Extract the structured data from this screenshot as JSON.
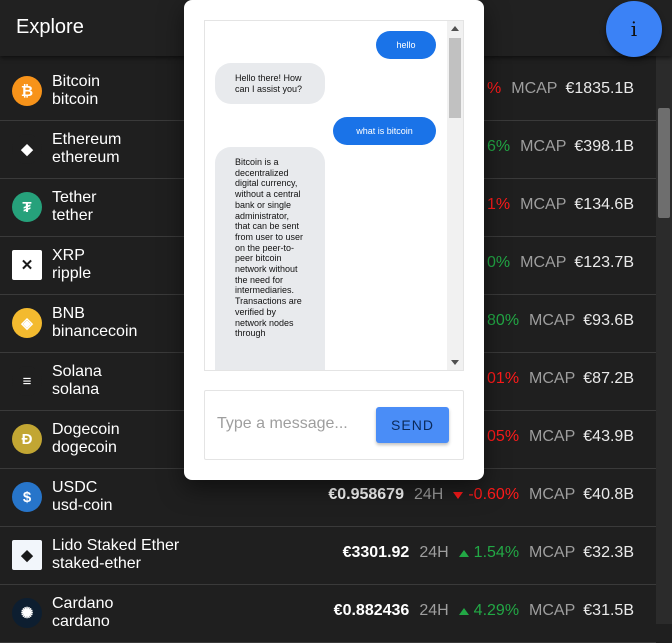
{
  "header": {
    "title": "Explore",
    "info_label": "i"
  },
  "coins": [
    {
      "name": "Bitcoin",
      "id": "bitcoin",
      "price": "",
      "period": "",
      "change": "%",
      "dir": "down",
      "mcap_label": "MCAP",
      "mcap": "€1835.1B",
      "icon_color": "#f7931a",
      "icon_glyph": "₿"
    },
    {
      "name": "Ethereum",
      "id": "ethereum",
      "price": "",
      "period": "",
      "change": "6%",
      "dir": "up",
      "mcap_label": "MCAP",
      "mcap": "€398.1B",
      "icon_color": "#1f1f1f",
      "icon_glyph": "◆"
    },
    {
      "name": "Tether",
      "id": "tether",
      "price": "",
      "period": "",
      "change": "1%",
      "dir": "down",
      "mcap_label": "MCAP",
      "mcap": "€134.6B",
      "icon_color": "#26a17b",
      "icon_glyph": "₮"
    },
    {
      "name": "XRP",
      "id": "ripple",
      "price": "",
      "period": "",
      "change": "0%",
      "dir": "up",
      "mcap_label": "MCAP",
      "mcap": "€123.7B",
      "icon_color": "#ffffff",
      "icon_glyph": "✕"
    },
    {
      "name": "BNB",
      "id": "binancecoin",
      "price": "",
      "period": "",
      "change": "80%",
      "dir": "up",
      "mcap_label": "MCAP",
      "mcap": "€93.6B",
      "icon_color": "#f3ba2f",
      "icon_glyph": "◈"
    },
    {
      "name": "Solana",
      "id": "solana",
      "price": "",
      "period": "",
      "change": "01%",
      "dir": "down",
      "mcap_label": "MCAP",
      "mcap": "€87.2B",
      "icon_color": "#1f1f1f",
      "icon_glyph": "≡"
    },
    {
      "name": "Dogecoin",
      "id": "dogecoin",
      "price": "",
      "period": "",
      "change": "05%",
      "dir": "down",
      "mcap_label": "MCAP",
      "mcap": "€43.9B",
      "icon_color": "#c2a633",
      "icon_glyph": "Ð"
    },
    {
      "name": "USDC",
      "id": "usd-coin",
      "price": "€0.958679",
      "period": "24H",
      "change": "-0.60%",
      "dir": "down",
      "mcap_label": "MCAP",
      "mcap": "€40.8B",
      "icon_color": "#2775ca",
      "icon_glyph": "$"
    },
    {
      "name": "Lido Staked Ether",
      "id": "staked-ether",
      "price": "€3301.92",
      "period": "24H",
      "change": "1.54%",
      "dir": "up",
      "mcap_label": "MCAP",
      "mcap": "€32.3B",
      "icon_color": "#f2f6fb",
      "icon_glyph": "◆"
    },
    {
      "name": "Cardano",
      "id": "cardano",
      "price": "€0.882436",
      "period": "24H",
      "change": "4.29%",
      "dir": "up",
      "mcap_label": "MCAP",
      "mcap": "€31.5B",
      "icon_color": "#0d1e30",
      "icon_glyph": "✺"
    }
  ],
  "chat": {
    "messages": [
      {
        "from": "user",
        "text": "hello"
      },
      {
        "from": "bot",
        "text": "Hello there! How can I assist you?"
      },
      {
        "from": "user",
        "text": "what is bitcoin"
      },
      {
        "from": "bot",
        "text": "Bitcoin is a decentralized digital currency, without a central bank or single administrator, that can be sent from user to user on the peer-to-peer bitcoin network without the need for intermediaries. Transactions are verified by network nodes through"
      }
    ],
    "input_placeholder": "Type a message...",
    "send_label": "SEND"
  },
  "colors": {
    "accent": "#3b82f6",
    "up": "#22a845",
    "down": "#ff1a1a",
    "background": "#1f1f1f"
  }
}
